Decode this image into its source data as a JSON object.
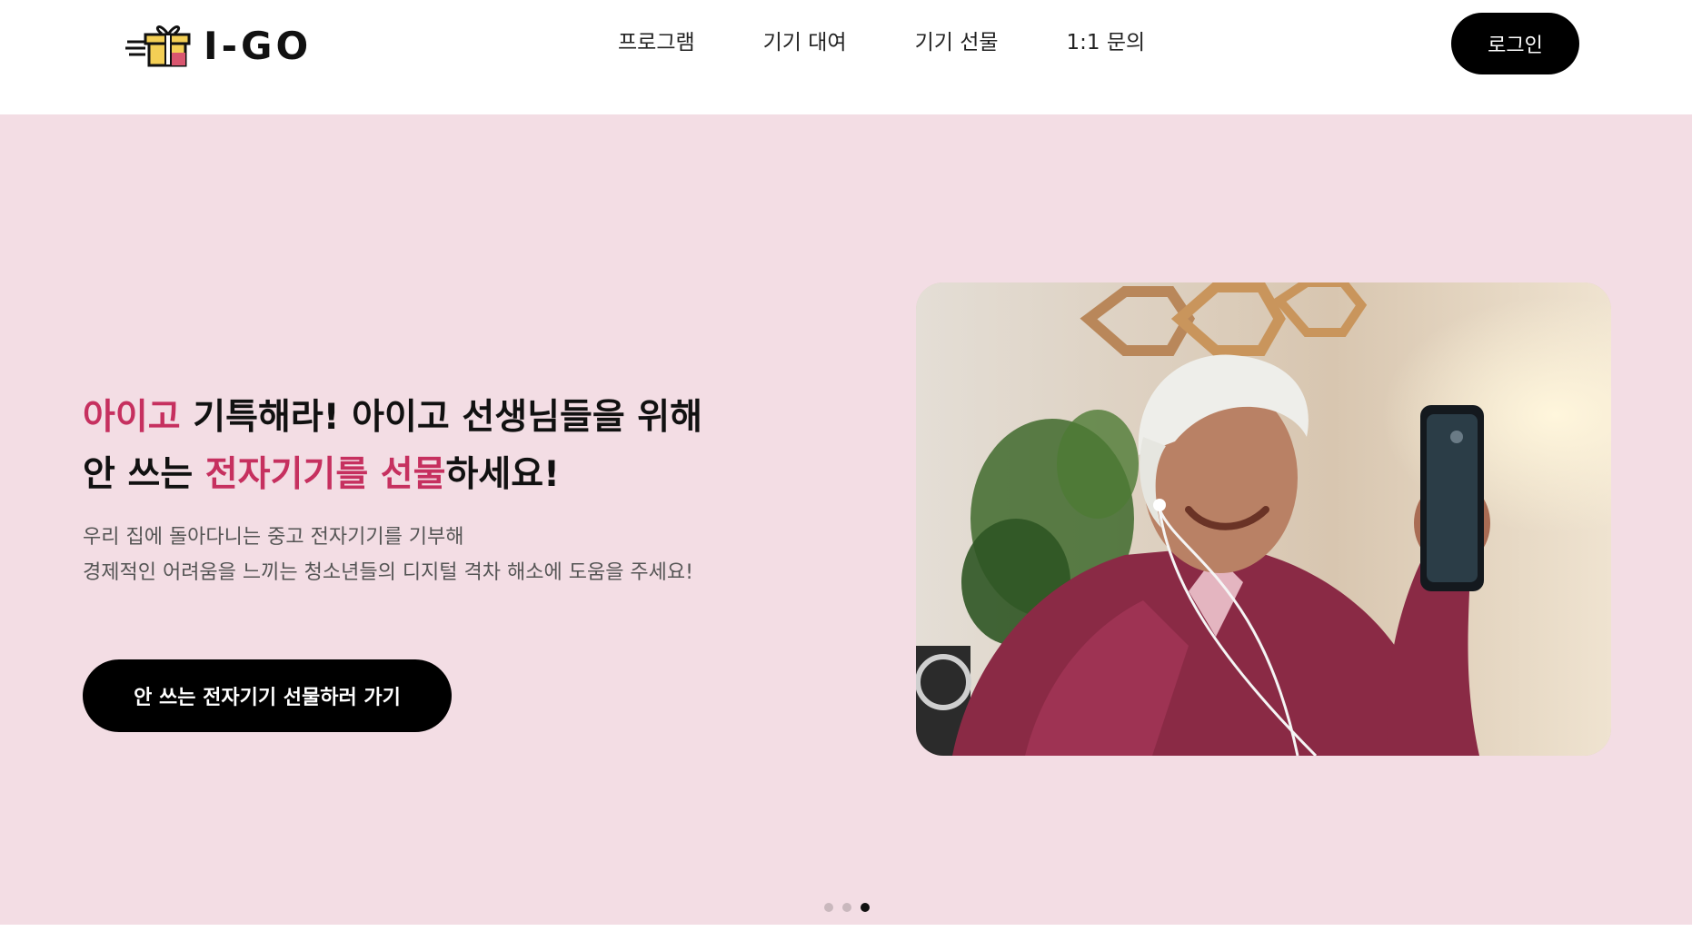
{
  "header": {
    "logo_text": "I-GO",
    "nav": [
      "프로그램",
      "기기 대여",
      "기기 선물",
      "1:1 문의"
    ],
    "login_label": "로그인"
  },
  "hero": {
    "headline_line1_accent": "아이고",
    "headline_line1_rest": " 기특해라! 아이고 선생님들을 위해",
    "headline_line2_start": "안 쓰는 ",
    "headline_line2_accent": "전자기기를 선물",
    "headline_line2_end": "하세요!",
    "sub_line1": "우리 집에 돌아다니는 중고 전자기기를 기부해",
    "sub_line2": "경제적인 어려움을 느끼는 청소년들의 디지털 격차 해소에 도움을 주세요!",
    "cta_label": "안 쓰는 전자기기 선물하러 가기",
    "image_alt": "smiling elderly woman video calling on smartphone",
    "slides_count": 3,
    "active_slide": 3
  },
  "colors": {
    "accent": "#c6305f",
    "hero_bg": "#f3dde4",
    "button_bg": "#000000"
  },
  "icons": {
    "logo": "gift-box-icon"
  }
}
